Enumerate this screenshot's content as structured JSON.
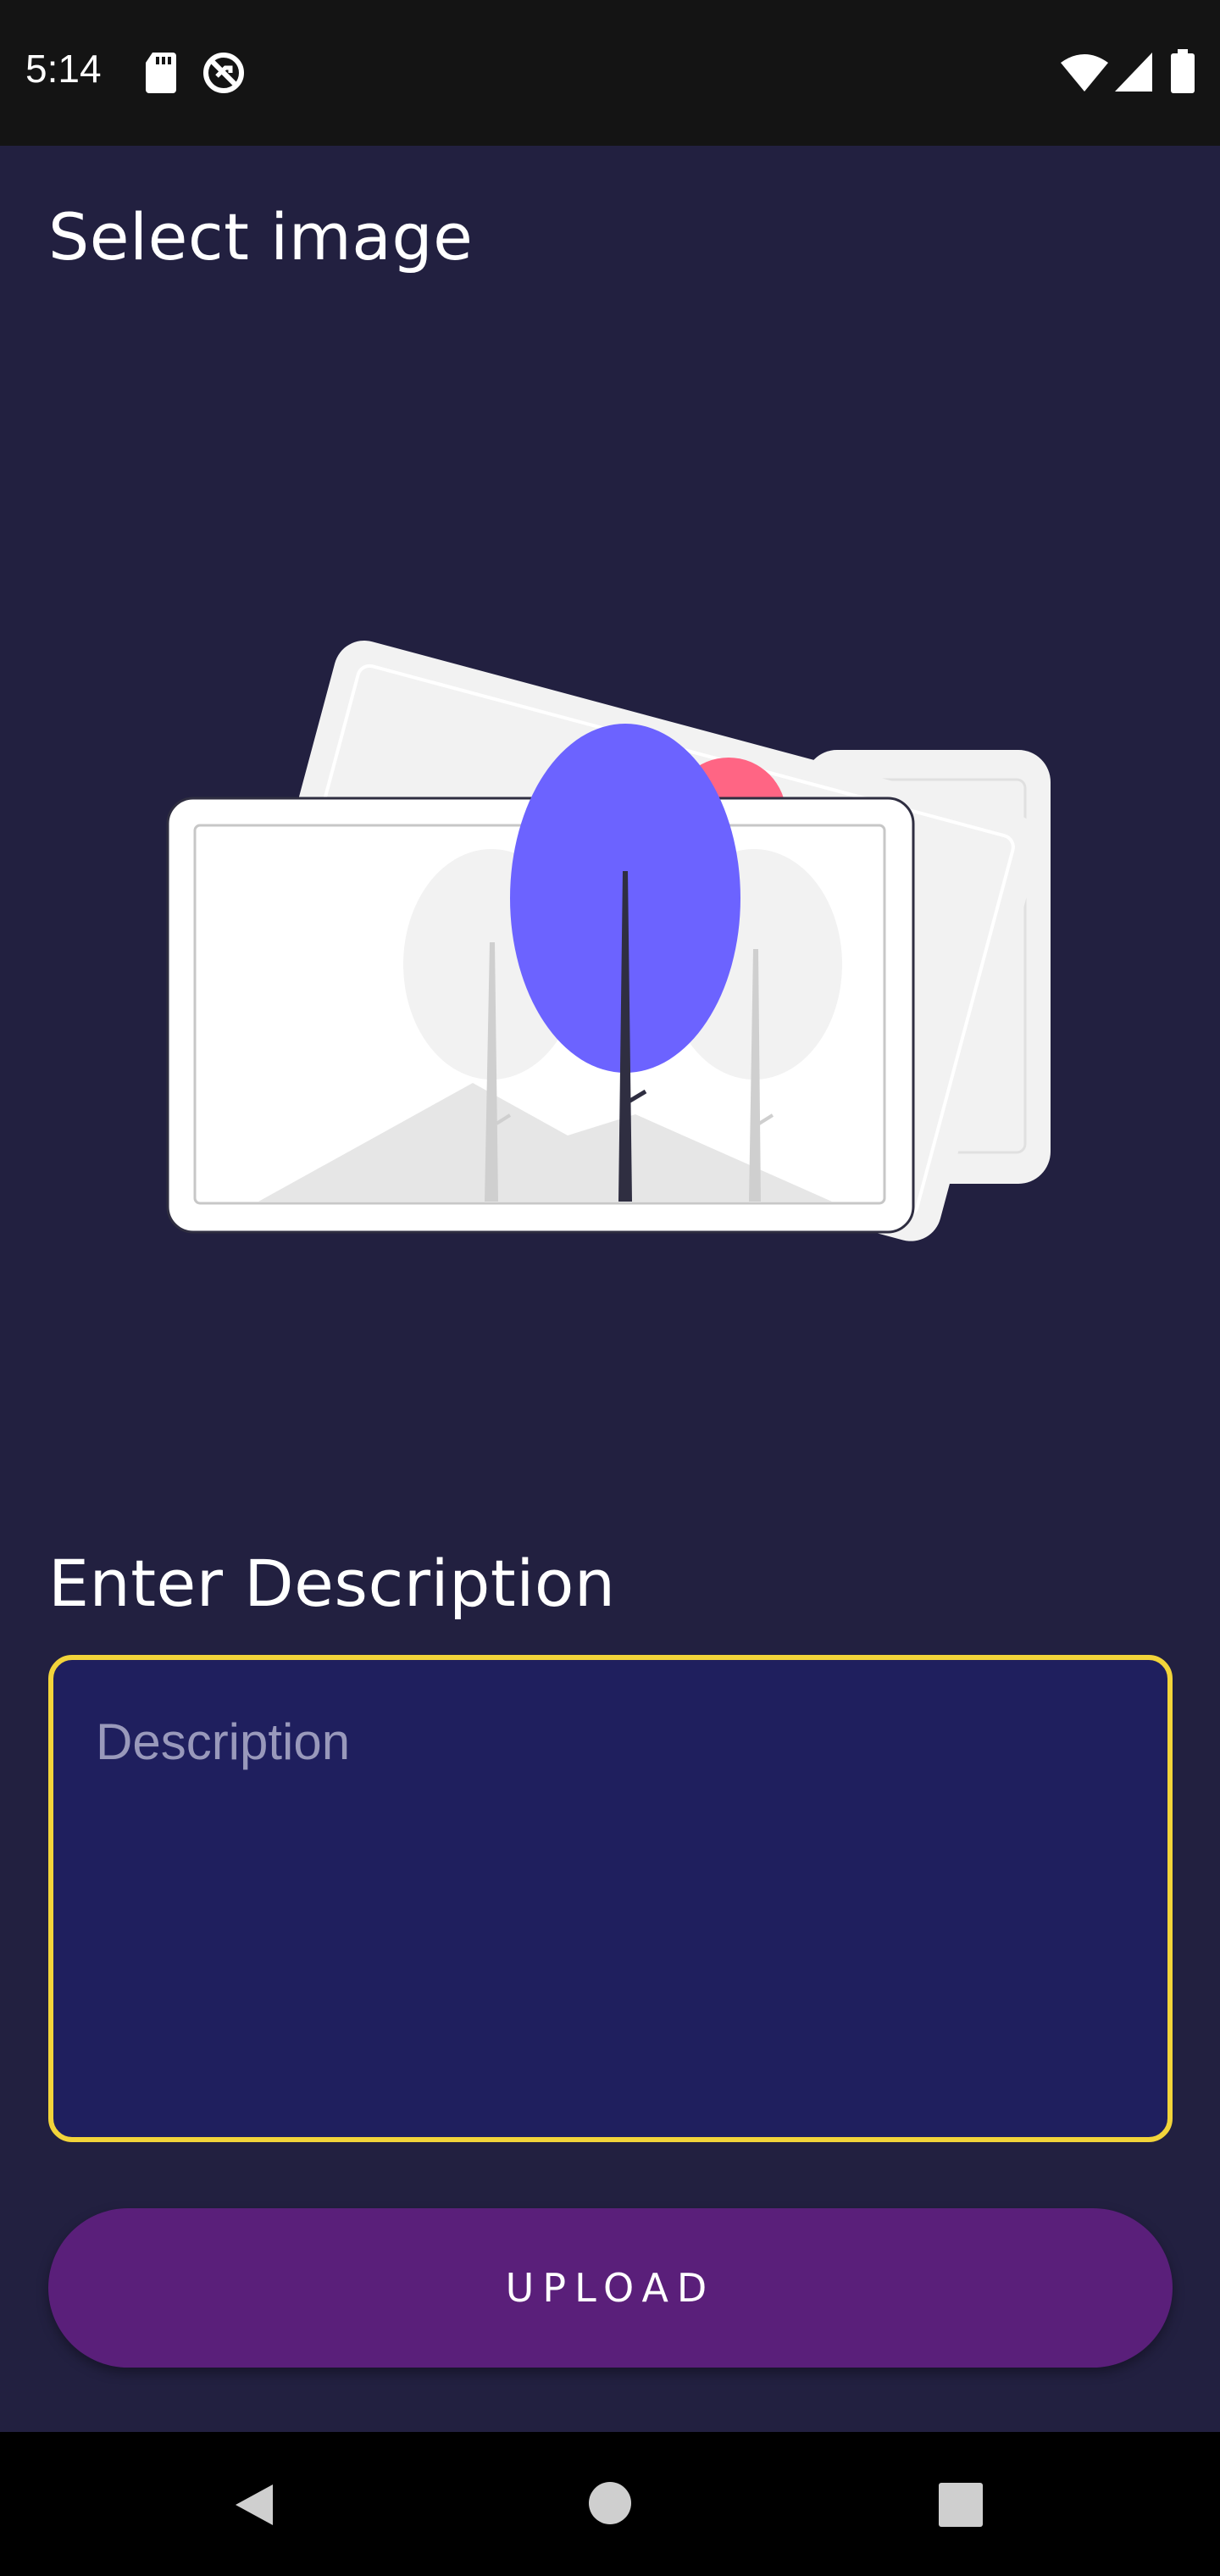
{
  "status_bar": {
    "time": "5:14",
    "icons": [
      "sd-card-icon",
      "sync-disabled-icon",
      "wifi-icon",
      "cell-signal-icon",
      "battery-icon"
    ]
  },
  "main": {
    "select_image_title": "Select image",
    "image_placeholder_icon": "image-illustration-icon",
    "description_title": "Enter Description",
    "description_field": {
      "value": "",
      "placeholder": "Description"
    },
    "upload_label": "UPLOAD"
  },
  "colors": {
    "background": "#222040",
    "field_border": "#f2d43a",
    "field_fill": "#1f1f5e",
    "button": "#5a1f7a",
    "tree_accent": "#6c63ff",
    "sun_accent": "#ff6584"
  },
  "nav_bar": {
    "icons": [
      "back-icon",
      "home-icon",
      "recent-apps-icon"
    ]
  }
}
